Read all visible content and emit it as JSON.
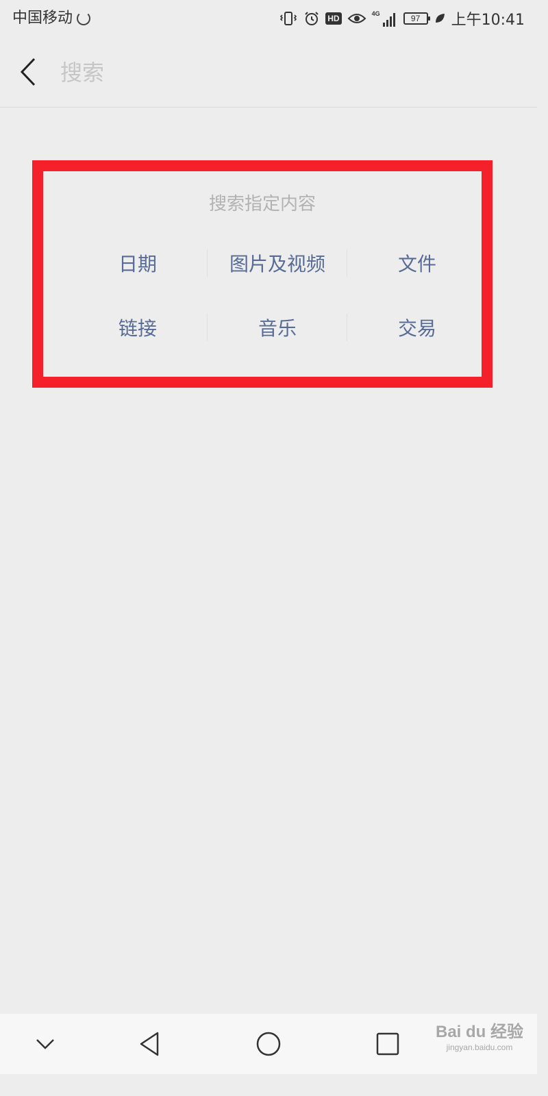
{
  "status_bar": {
    "carrier": "中国移动",
    "hd_label": "HD",
    "network_label": "4G",
    "battery_level": "97",
    "time": "上午10:41"
  },
  "header": {
    "back_icon": "chevron-left-icon",
    "search_placeholder": "搜索"
  },
  "search_panel": {
    "title": "搜索指定内容",
    "rows": [
      [
        {
          "label": "日期"
        },
        {
          "label": "图片及视频"
        },
        {
          "label": "文件"
        }
      ],
      [
        {
          "label": "链接"
        },
        {
          "label": "音乐"
        },
        {
          "label": "交易"
        }
      ]
    ],
    "highlight_color": "#f4212a",
    "link_color": "#576b95"
  },
  "navbar": {
    "buttons": [
      "chevron-down-icon",
      "back-triangle-icon",
      "home-circle-icon",
      "recents-square-icon"
    ]
  },
  "watermark": {
    "brand": "Bai du 经验",
    "url": "jingyan.baidu.com"
  }
}
